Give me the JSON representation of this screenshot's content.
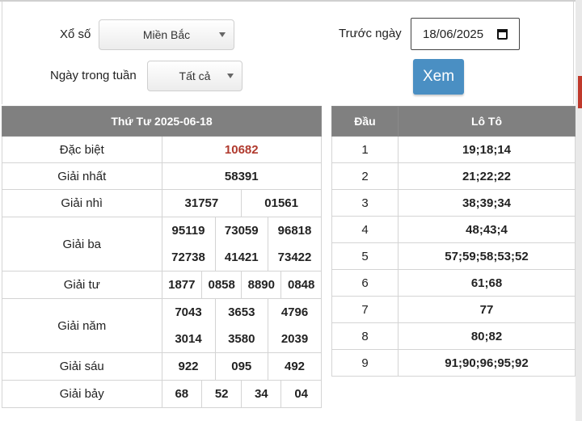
{
  "filters": {
    "lottery_label": "Xổ số",
    "lottery_value": "Miền Bắc",
    "weekday_label": "Ngày trong tuần",
    "weekday_value": "Tất cả",
    "before_label": "Trước ngày",
    "date_value": "18/06/2025",
    "submit_label": "Xem"
  },
  "results": {
    "header": "Thứ Tư 2025-06-18",
    "dac_biet": {
      "label": "Đặc biệt",
      "numbers": [
        "10682"
      ]
    },
    "giai_nhat": {
      "label": "Giải nhất",
      "numbers": [
        "58391"
      ]
    },
    "giai_nhi": {
      "label": "Giải nhì",
      "numbers": [
        "31757",
        "01561"
      ]
    },
    "giai_ba": {
      "label": "Giải ba",
      "numbers": [
        "95119",
        "73059",
        "96818",
        "72738",
        "41421",
        "73422"
      ]
    },
    "giai_tu": {
      "label": "Giải tư",
      "numbers": [
        "1877",
        "0858",
        "8890",
        "0848"
      ]
    },
    "giai_nam": {
      "label": "Giải năm",
      "numbers": [
        "7043",
        "3653",
        "4796",
        "3014",
        "3580",
        "2039"
      ]
    },
    "giai_sau": {
      "label": "Giải sáu",
      "numbers": [
        "922",
        "095",
        "492"
      ]
    },
    "giai_bay": {
      "label": "Giải bảy",
      "numbers": [
        "68",
        "52",
        "34",
        "04"
      ]
    }
  },
  "loto": {
    "col_dau": "Đầu",
    "col_loto": "Lô Tô",
    "rows": [
      {
        "dau": "1",
        "loto": "19;18;14"
      },
      {
        "dau": "2",
        "loto": "21;22;22"
      },
      {
        "dau": "3",
        "loto": "38;39;34"
      },
      {
        "dau": "4",
        "loto": "48;43;4"
      },
      {
        "dau": "5",
        "loto": "57;59;58;53;52"
      },
      {
        "dau": "6",
        "loto": "61;68"
      },
      {
        "dau": "7",
        "loto": "77"
      },
      {
        "dau": "8",
        "loto": "80;82"
      },
      {
        "dau": "9",
        "loto": "91;90;96;95;92"
      }
    ]
  },
  "colors": {
    "header_bg": "#808080",
    "special_prize": "#b03a2e",
    "button_bg": "#4a8fc3"
  }
}
